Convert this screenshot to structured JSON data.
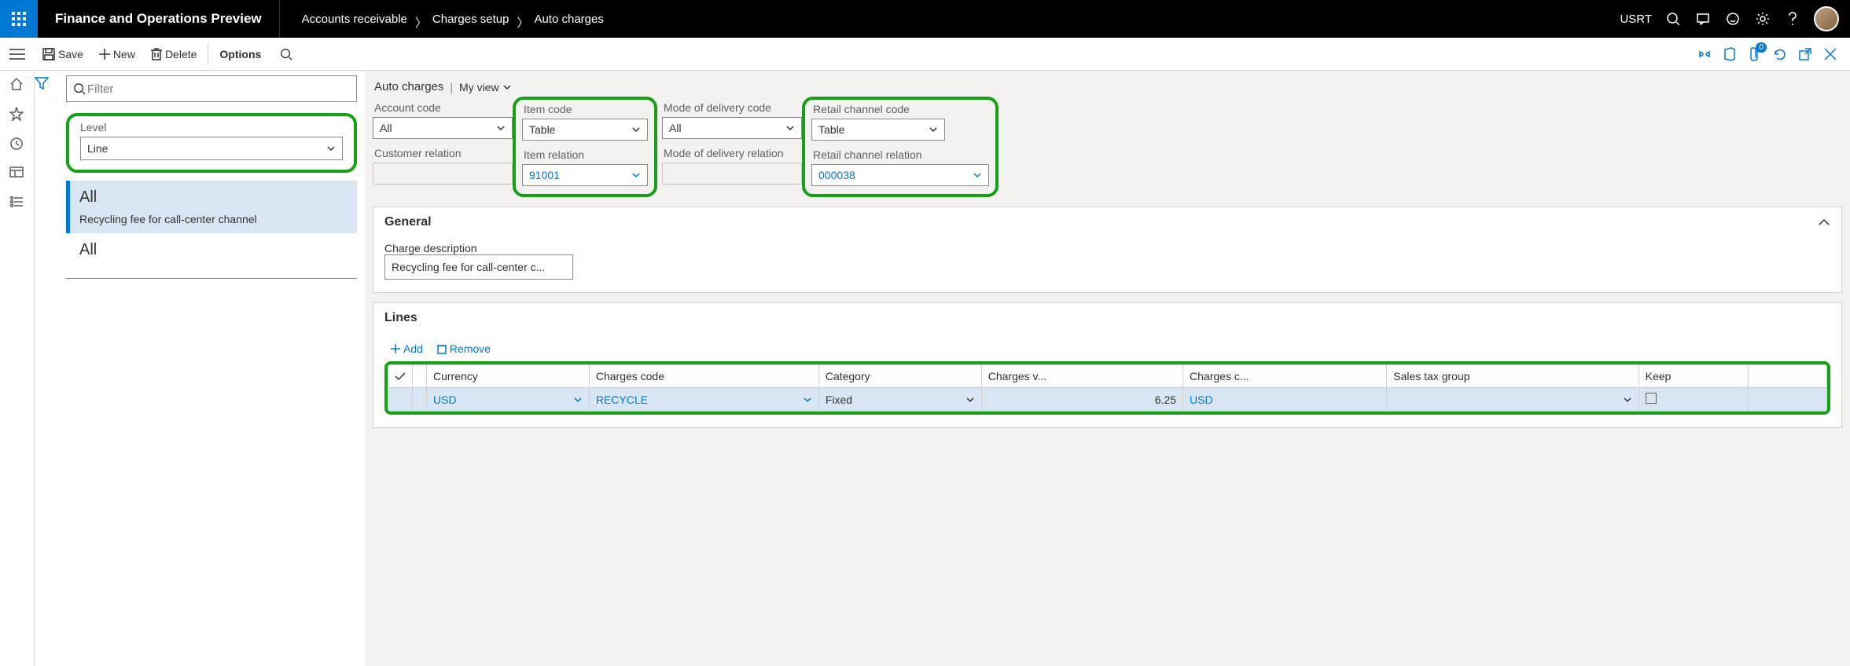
{
  "topbar": {
    "title": "Finance and Operations Preview",
    "breadcrumb": [
      "Accounts receivable",
      "Charges setup",
      "Auto charges"
    ],
    "company": "USRT"
  },
  "cmds": {
    "save": "Save",
    "new": "New",
    "delete": "Delete",
    "options": "Options"
  },
  "left": {
    "filter_placeholder": "Filter",
    "level_label": "Level",
    "level_value": "Line",
    "items": [
      {
        "title": "All",
        "sub": "Recycling fee for call-center channel",
        "active": true
      },
      {
        "title": "All",
        "sub": "",
        "active": false
      }
    ]
  },
  "main": {
    "page": "Auto charges",
    "view": "My view",
    "fields": {
      "account_code": {
        "label": "Account code",
        "value": "All"
      },
      "customer_relation": {
        "label": "Customer relation",
        "value": ""
      },
      "item_code": {
        "label": "Item code",
        "value": "Table"
      },
      "item_relation": {
        "label": "Item relation",
        "value": "91001"
      },
      "mode_code": {
        "label": "Mode of delivery code",
        "value": "All"
      },
      "mode_relation": {
        "label": "Mode of delivery relation",
        "value": ""
      },
      "retail_code": {
        "label": "Retail channel code",
        "value": "Table"
      },
      "retail_relation": {
        "label": "Retail channel relation",
        "value": "000038"
      }
    },
    "general": {
      "heading": "General",
      "charge_desc_label": "Charge description",
      "charge_desc_value": "Recycling fee for call-center c..."
    },
    "lines": {
      "heading": "Lines",
      "add": "Add",
      "remove": "Remove",
      "columns": [
        "",
        "",
        "Currency",
        "Charges code",
        "Category",
        "Charges v...",
        "Charges c...",
        "Sales tax group",
        "Keep",
        ""
      ],
      "row": {
        "currency": "USD",
        "charges_code": "RECYCLE",
        "category": "Fixed",
        "charges_value": "6.25",
        "charges_currency": "USD",
        "sales_tax": "",
        "keep": false
      }
    }
  }
}
